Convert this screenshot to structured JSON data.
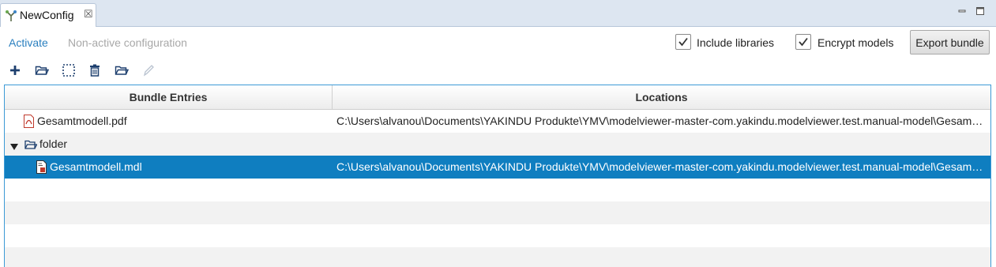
{
  "tab": {
    "title": "NewConfig",
    "close": "☒"
  },
  "header": {
    "activate_label": "Activate",
    "status_text": "Non-active configuration",
    "include_libraries": {
      "label": "Include libraries",
      "checked": true
    },
    "encrypt_models": {
      "label": "Encrypt models",
      "checked": true
    },
    "export_label": "Export bundle"
  },
  "toolbar": {
    "items": [
      "add-icon",
      "open-folder-icon",
      "select-area-icon",
      "delete-icon",
      "folder-icon",
      "edit-pencil-icon"
    ]
  },
  "table": {
    "columns": [
      "Bundle Entries",
      "Locations"
    ],
    "rows": [
      {
        "name": "Gesamtmodell.pdf",
        "location": "C:\\Users\\alvanou\\Documents\\YAKINDU Produkte\\YMV\\modelviewer-master-com.yakindu.modelviewer.test.manual-model\\Gesamtmodell.pdf",
        "icon": "pdf-file-icon"
      },
      {
        "name": "folder",
        "location": "",
        "icon": "folder-icon",
        "expanded": true
      },
      {
        "name": "Gesamtmodell.mdl",
        "location": "C:\\Users\\alvanou\\Documents\\YAKINDU Produkte\\YMV\\modelviewer-master-com.yakindu.modelviewer.test.manual-model\\Gesamtmodell.mdl",
        "icon": "mdl-file-icon",
        "selected": true
      }
    ]
  },
  "colors": {
    "selection": "#0f7ec0",
    "link": "#2a7fbf",
    "tabbar": "#dde6f1"
  }
}
